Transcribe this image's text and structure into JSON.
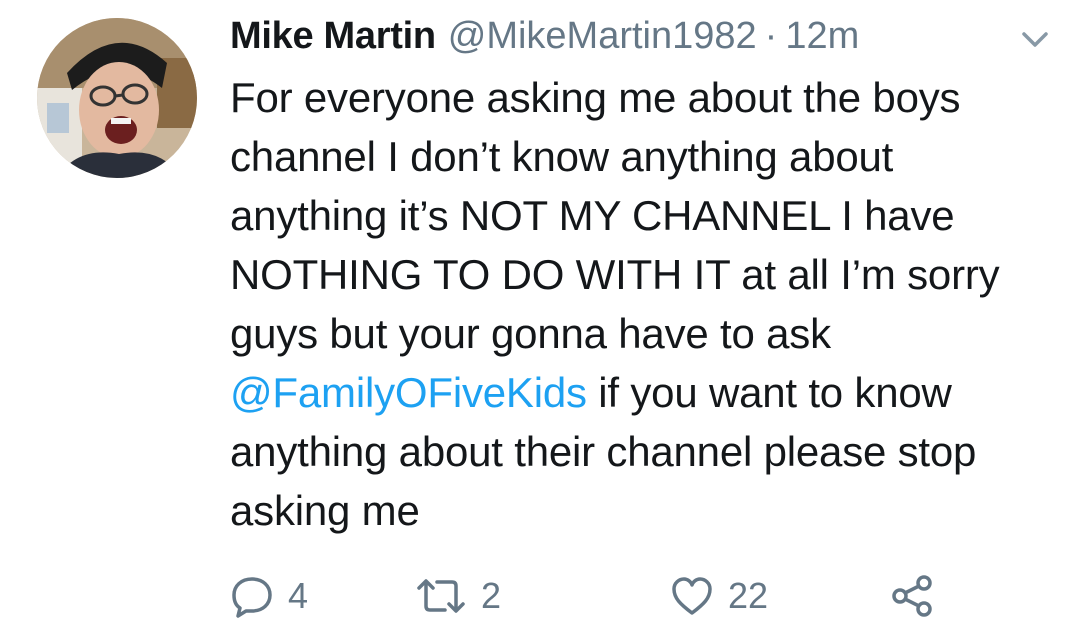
{
  "tweet": {
    "author_name": "Mike Martin",
    "author_handle": "@MikeMartin1982",
    "separator": "·",
    "time": "12m",
    "text_before_mention": "For everyone asking me about the boys channel I don’t know anything about anything it’s NOT MY CHANNEL I have NOTHING TO DO WITH IT at all I’m sorry guys but your gonna have to ask ",
    "mention": "@FamilyOFiveKids",
    "text_after_mention": " if you want to know anything about their channel please stop asking me"
  },
  "actions": {
    "reply_count": "4",
    "retweet_count": "2",
    "like_count": "22"
  },
  "icons": {
    "reply": "speech-bubble-icon",
    "retweet": "retweet-arrows-icon",
    "like": "heart-icon",
    "share": "share-icon",
    "menu": "chevron-down-icon"
  },
  "colors": {
    "text": "#14171a",
    "secondary": "#657786",
    "link": "#1da1f2"
  }
}
